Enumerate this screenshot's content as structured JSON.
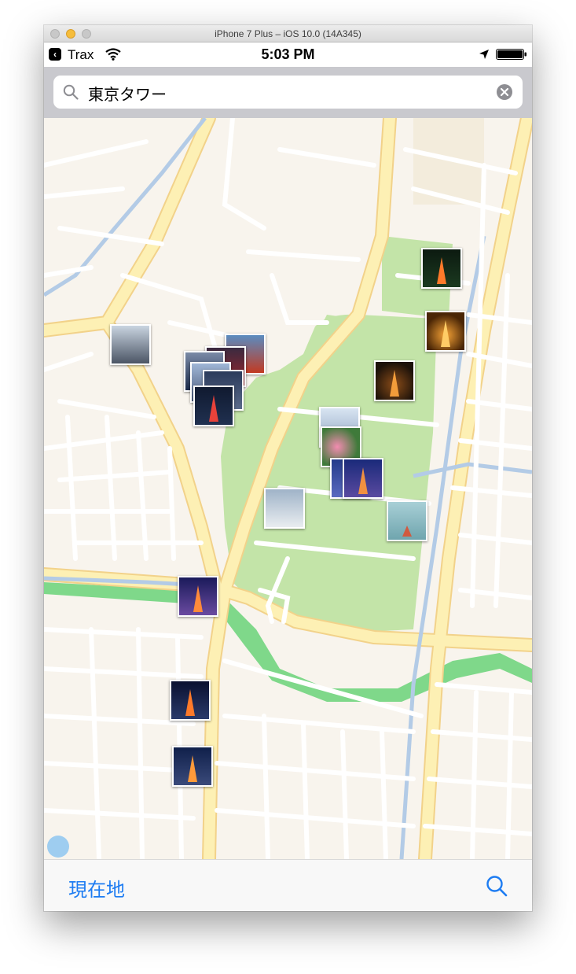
{
  "window": {
    "title": "iPhone 7 Plus – iOS 10.0 (14A345)"
  },
  "status_bar": {
    "back_app": "Trax",
    "time": "5:03 PM",
    "icons": [
      "back-chevron-icon",
      "wifi-icon",
      "location-arrow-icon",
      "battery-icon"
    ]
  },
  "search": {
    "query": "東京タワー",
    "icons": [
      "search-icon",
      "clear-icon"
    ]
  },
  "map": {
    "photo_pins": [
      {
        "name": "tower-night-green"
      },
      {
        "name": "tower-orange-glow"
      },
      {
        "name": "tower-dusk"
      },
      {
        "name": "city-skyline"
      },
      {
        "name": "photo-stack"
      },
      {
        "name": "park-flowers"
      },
      {
        "name": "temple-tower"
      },
      {
        "name": "tower-sky"
      },
      {
        "name": "apartment-building"
      },
      {
        "name": "street-light-trails"
      },
      {
        "name": "night-street"
      },
      {
        "name": "street-tower"
      }
    ]
  },
  "toolbar": {
    "current_location_label": "現在地",
    "search_icon": "search-icon"
  },
  "colors": {
    "accent": "#1d7cf2",
    "park": "#c3e4a8",
    "road_major": "#fdf0b4",
    "river": "#7fd88a"
  }
}
